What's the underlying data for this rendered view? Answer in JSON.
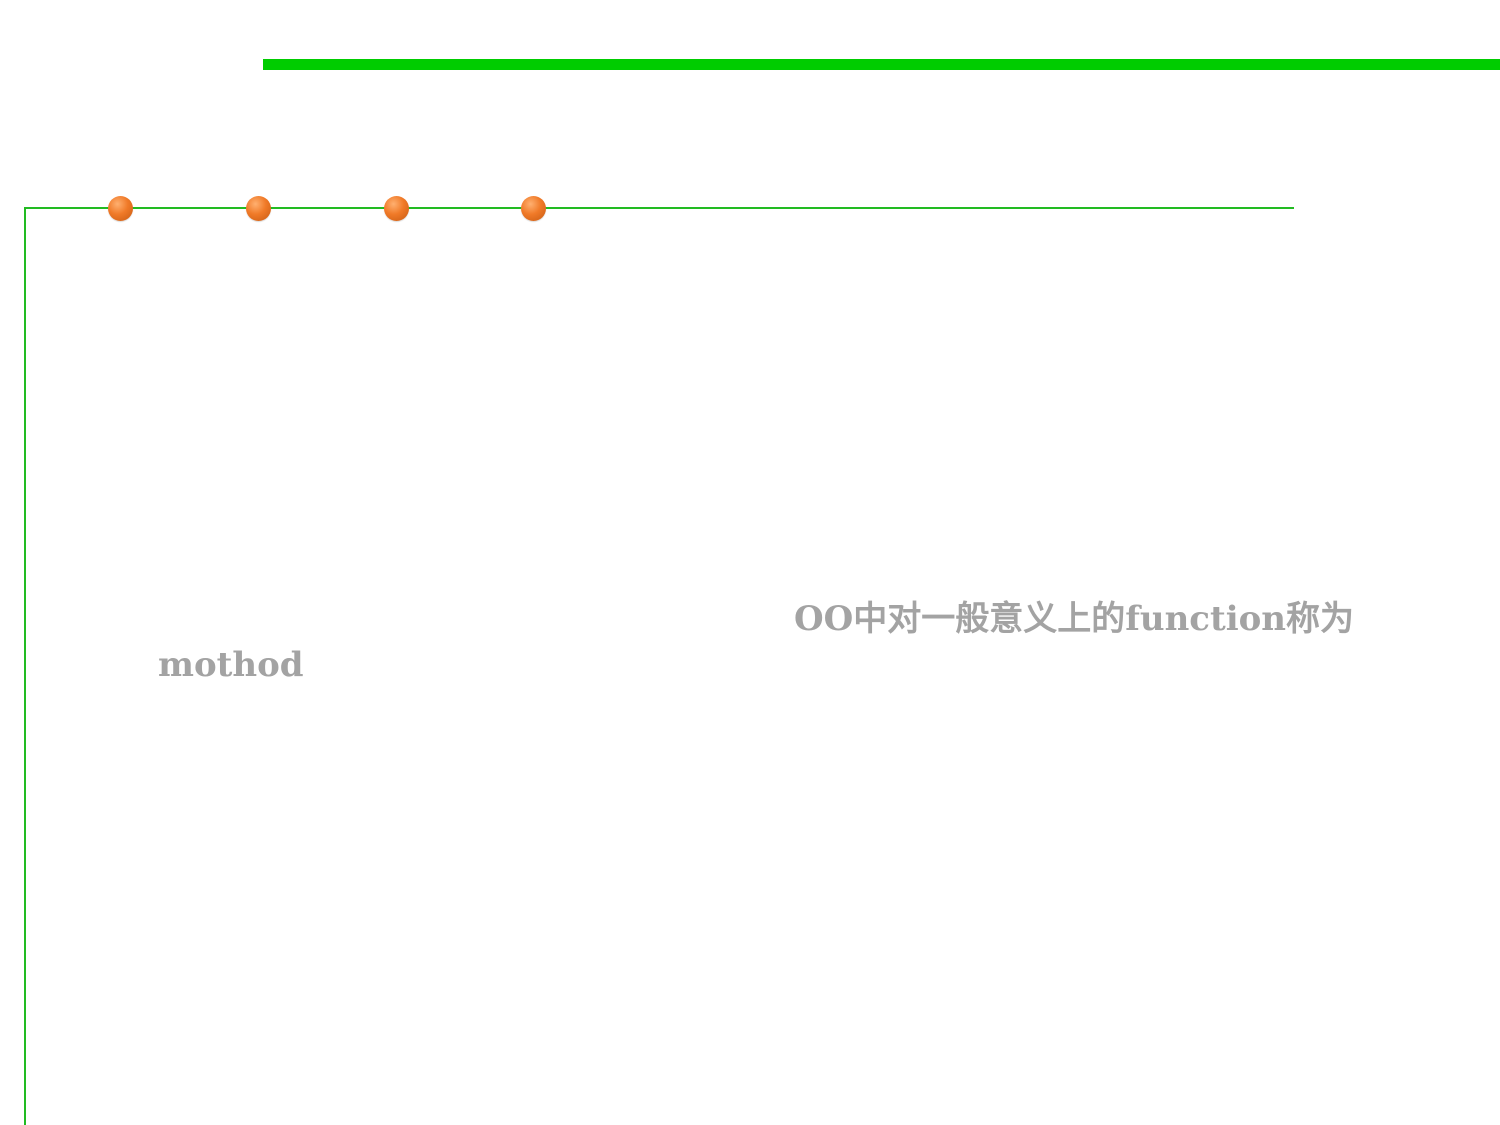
{
  "slide": {
    "body_line_1": "OO中对一般意义上的function称为",
    "body_line_2": "mothod"
  },
  "colors": {
    "accent_bar": "#00cc00",
    "frame_line": "#22bb22",
    "bullet_dot": "#f07a28",
    "text": "#a3a3a3"
  }
}
